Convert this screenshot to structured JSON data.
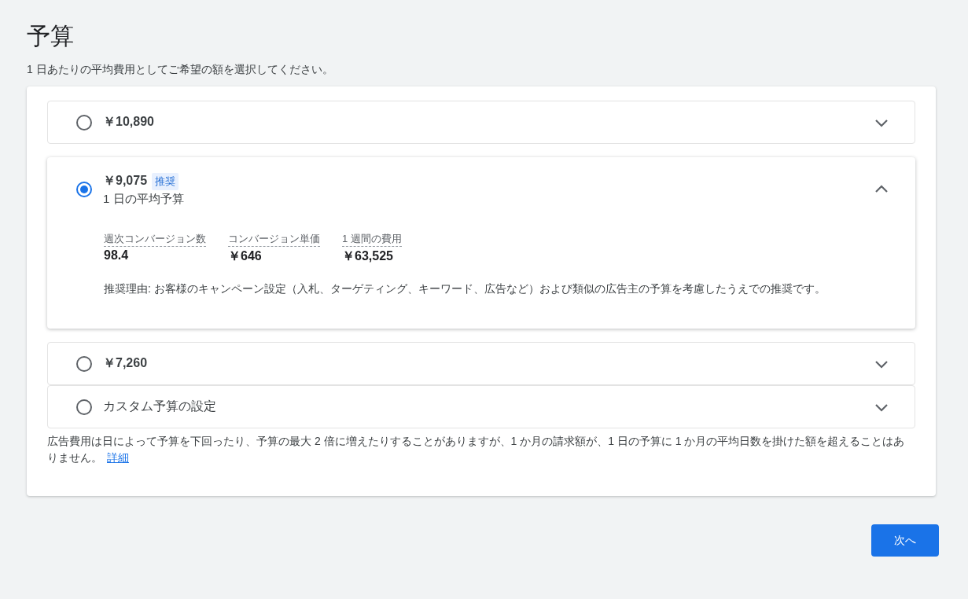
{
  "title": "予算",
  "subtitle": "1 日あたりの平均費用としてご希望の額を選択してください。",
  "options": [
    {
      "label": "￥10,890",
      "selected": false,
      "expanded": false
    },
    {
      "label": "￥9,075",
      "badge": "推奨",
      "caption": "1 日の平均予算",
      "selected": true,
      "expanded": true,
      "metrics": [
        {
          "label": "週次コンバージョン数",
          "value": "98.4"
        },
        {
          "label": "コンバージョン単価",
          "value": "￥646"
        },
        {
          "label": "1 週間の費用",
          "value": "￥63,525"
        }
      ],
      "reason": "推奨理由: お客様のキャンペーン設定（入札、ターゲティング、キーワード、広告など）および類似の広告主の予算を考慮したうえでの推奨です。"
    },
    {
      "label": "￥7,260",
      "selected": false,
      "expanded": false
    },
    {
      "label": "カスタム予算の設定",
      "kind": "custom",
      "selected": false,
      "expanded": false
    }
  ],
  "note": "広告費用は日によって予算を下回ったり、予算の最大 2 倍に増えたりすることがありますが、1 か月の請求額が、1 日の予算に 1 か月の平均日数を掛けた額を超えることはありません。",
  "note_link": "詳細",
  "next_button": "次へ"
}
